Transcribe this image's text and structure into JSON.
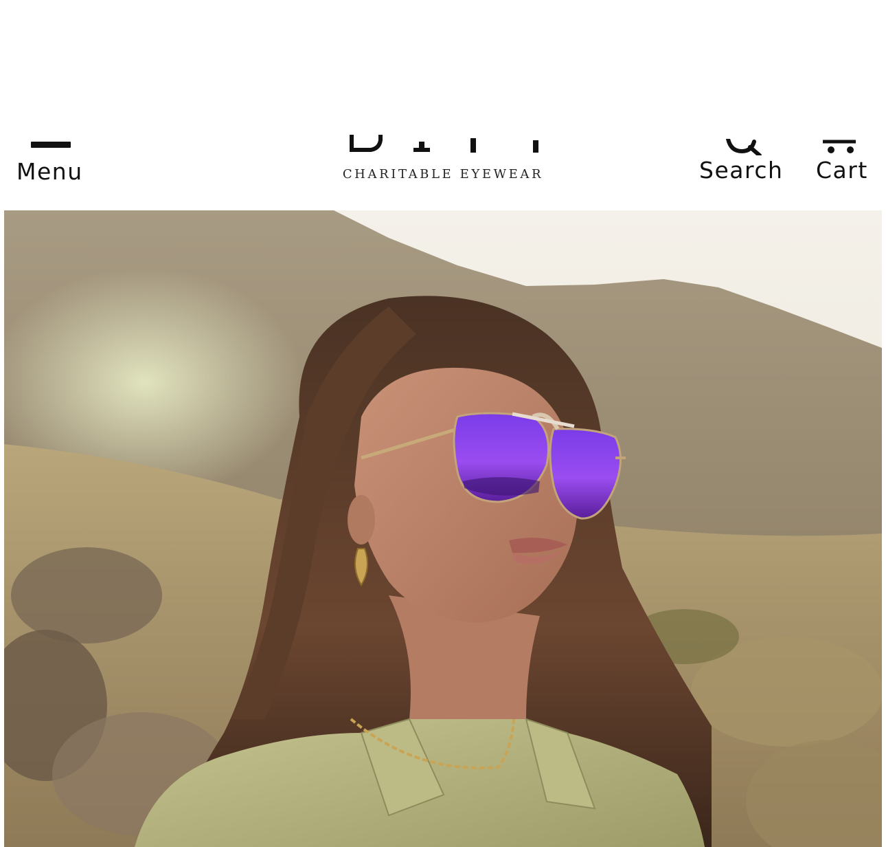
{
  "header": {
    "menu_label": "Menu",
    "search_label": "Search",
    "cart_label": "Cart",
    "logo_tagline": "CHARITABLE EYEWEAR",
    "icons": {
      "menu": "hamburger-menu-icon",
      "search": "magnifier-search-icon",
      "cart": "shopping-cart-icon"
    }
  },
  "hero": {
    "image": "photo-woman-purple-mirrored-aviator-sunglasses-desert",
    "colors": {
      "lens": "#8a3fe6",
      "sky": "#f1ede4",
      "mountain": "#9d8e75",
      "shirt": "#b6b47e"
    }
  }
}
